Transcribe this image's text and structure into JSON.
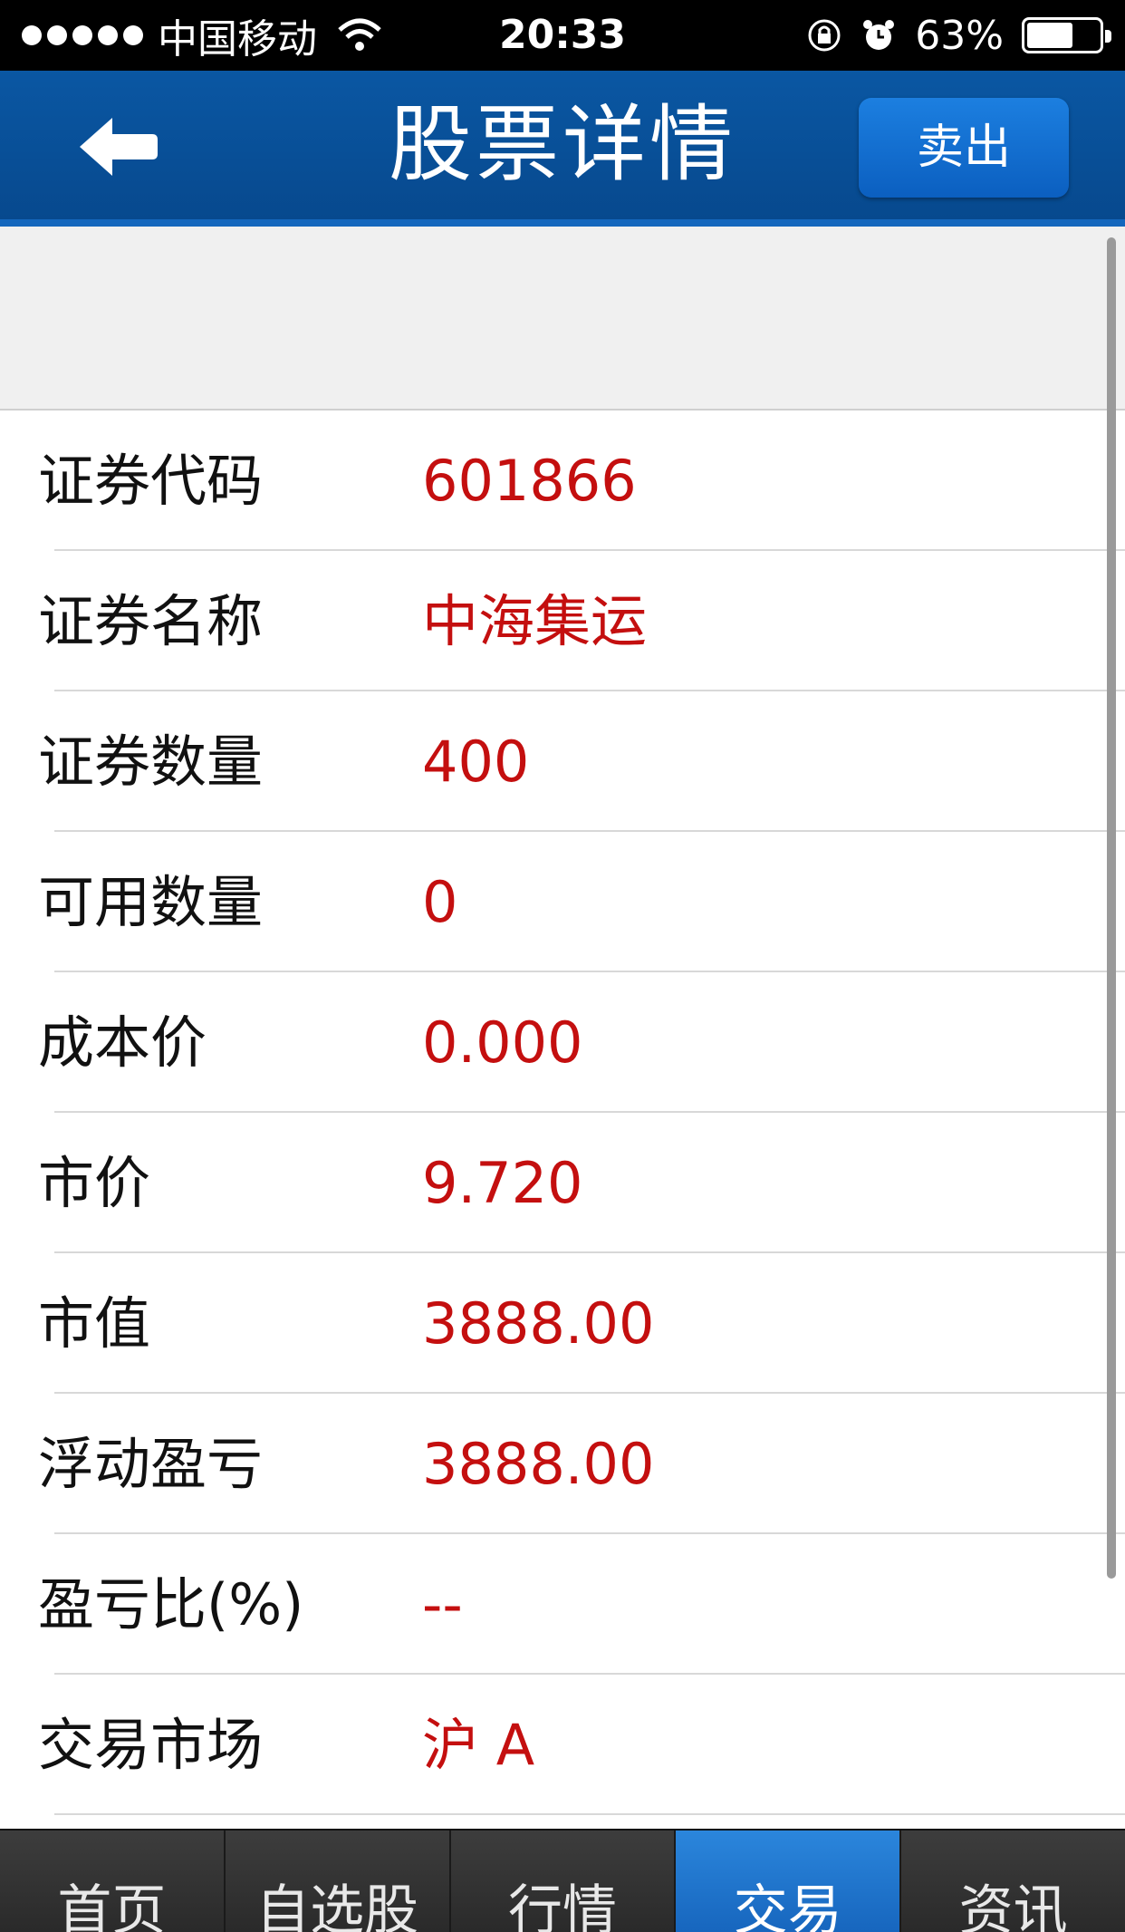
{
  "status_bar": {
    "carrier": "中国移动",
    "time": "20:33",
    "battery": "63%"
  },
  "header": {
    "title": "股票详情",
    "sell_label": "卖出"
  },
  "details": [
    {
      "label": "证券代码",
      "value": "601866"
    },
    {
      "label": "证券名称",
      "value": "中海集运"
    },
    {
      "label": "证券数量",
      "value": "400"
    },
    {
      "label": "可用数量",
      "value": "0"
    },
    {
      "label": "成本价",
      "value": "0.000"
    },
    {
      "label": "市价",
      "value": "9.720"
    },
    {
      "label": "市值",
      "value": "3888.00"
    },
    {
      "label": "浮动盈亏",
      "value": "3888.00"
    },
    {
      "label": "盈亏比(%)",
      "value": "--"
    },
    {
      "label": "交易市场",
      "value": "沪 A"
    }
  ],
  "tabs": [
    {
      "label": "首页",
      "active": false
    },
    {
      "label": "自选股",
      "active": false
    },
    {
      "label": "行情",
      "active": false
    },
    {
      "label": "交易",
      "active": true
    },
    {
      "label": "资讯",
      "active": false
    }
  ],
  "colors": {
    "header_bg": "#07498e",
    "value_red": "#c40f0f",
    "active_tab": "#1f76cf"
  }
}
